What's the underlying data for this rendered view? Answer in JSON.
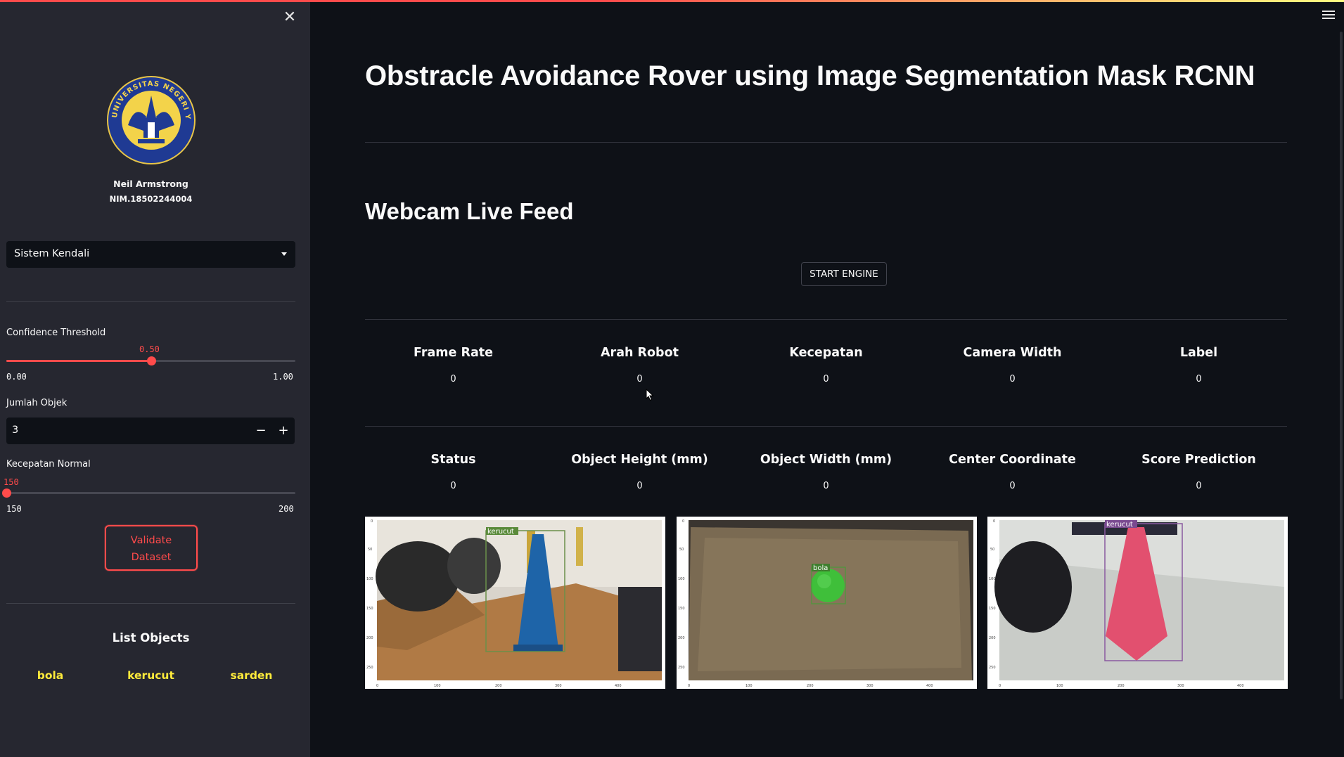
{
  "sidebar": {
    "close_icon": "close-icon",
    "logo_icon": "university-seal",
    "logo_text": "UNIVERSITAS NEGERI YOGYAKARTA",
    "name": "Neil Armstrong",
    "nim": "NIM.18502244004",
    "mode_select": {
      "value": "Sistem Kendali"
    },
    "confidence": {
      "label": "Confidence Threshold",
      "value_text": "0.50",
      "value": 0.5,
      "min_text": "0.00",
      "max_text": "1.00"
    },
    "jumlah_objek": {
      "label": "Jumlah Objek",
      "value": "3",
      "minus": "−",
      "plus": "+"
    },
    "kecepatan": {
      "label": "Kecepatan Normal",
      "value_text": "150",
      "value": 150,
      "min": 150,
      "max": 200,
      "min_text": "150",
      "max_text": "200"
    },
    "validate_button": {
      "line1": "Validate",
      "line2": "Dataset"
    },
    "list_title": "List Objects",
    "objects": [
      "bola",
      "kerucut",
      "sarden"
    ]
  },
  "main": {
    "title": "Obstracle Avoidance Rover using Image Segmentation Mask RCNN",
    "section": "Webcam Live Feed",
    "start_button": "START ENGINE",
    "metrics_row1": [
      {
        "label": "Frame Rate",
        "value": "0"
      },
      {
        "label": "Arah Robot",
        "value": "0"
      },
      {
        "label": "Kecepatan",
        "value": "0"
      },
      {
        "label": "Camera Width",
        "value": "0"
      },
      {
        "label": "Label",
        "value": "0"
      }
    ],
    "metrics_row2": [
      {
        "label": "Status",
        "value": "0"
      },
      {
        "label": "Object Height (mm)",
        "value": "0"
      },
      {
        "label": "Object Width (mm)",
        "value": "0"
      },
      {
        "label": "Center Coordinate",
        "value": "0"
      },
      {
        "label": "Score Prediction",
        "value": "0"
      }
    ],
    "images": [
      {
        "label": "kerucut",
        "desc": "blue cone on wooden table next to helmets"
      },
      {
        "label": "bola",
        "desc": "green ball on brown shaggy rug"
      },
      {
        "label": "kerucut",
        "desc": "red cone on tiled floor"
      }
    ],
    "axis_ticks_x": [
      "0",
      "100",
      "200",
      "300",
      "400"
    ],
    "axis_ticks_y": [
      "0",
      "50",
      "100",
      "150",
      "200",
      "250"
    ]
  },
  "header": {
    "menu_icon": "hamburger-menu-icon"
  },
  "colors": {
    "accent": "#ff4b4b",
    "sidebar_bg": "#262730",
    "main_bg": "#0e1117",
    "object_label": "#ffeb3b"
  }
}
